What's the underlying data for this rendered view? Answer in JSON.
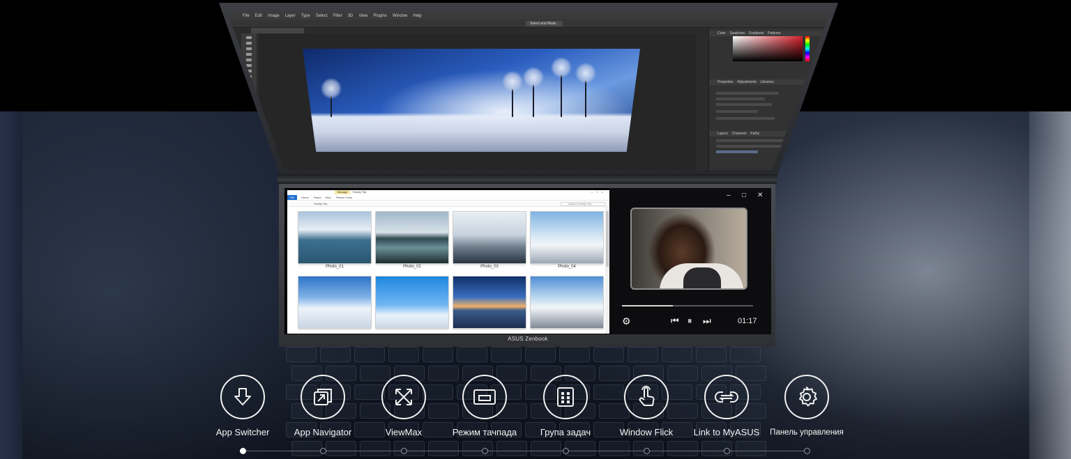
{
  "photoshop": {
    "menu": [
      "File",
      "Edit",
      "Image",
      "Layer",
      "Type",
      "Select",
      "Filter",
      "3D",
      "View",
      "Plugins",
      "Window",
      "Help"
    ],
    "options_button": "Select and Mask...",
    "panel_tabs": [
      "Color",
      "Swatches",
      "Gradients",
      "Patterns"
    ],
    "properties_tabs": [
      "Properties",
      "Adjustments",
      "Libraries"
    ],
    "layers_tabs": [
      "Layers",
      "Channels",
      "Paths"
    ]
  },
  "explorer": {
    "manage_tab": "Manage",
    "title": "Family Trip",
    "ribbon_file": "File",
    "ribbon_tabs": [
      "Home",
      "Share",
      "View",
      "Picture Tools"
    ],
    "breadcrumb": "Family Trip",
    "search_placeholder": "Search Family Trip",
    "photos": [
      "Photo_01",
      "Photo_02",
      "Photo_03",
      "Photo_04"
    ]
  },
  "player": {
    "time": "01:17",
    "progress": 0.39
  },
  "brand": "ASUS Zenbook",
  "features": [
    {
      "label": "App Switcher",
      "icon": "download-arrow-icon"
    },
    {
      "label": "App Navigator",
      "icon": "app-navigator-icon"
    },
    {
      "label": "ViewMax",
      "icon": "expand-arrows-icon"
    },
    {
      "label": "Режим тачпада",
      "icon": "touchpad-icon"
    },
    {
      "label": "Група задач",
      "icon": "task-group-icon"
    },
    {
      "label": "Window Flick",
      "icon": "hand-tap-icon"
    },
    {
      "label": "Link to MyASUS",
      "icon": "link-icon"
    },
    {
      "label": "Панель управления",
      "icon": "gear-icon"
    }
  ],
  "active_feature": 0
}
